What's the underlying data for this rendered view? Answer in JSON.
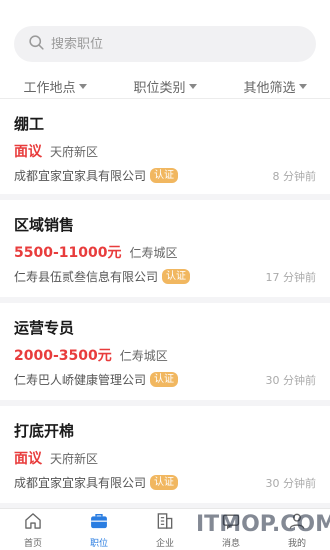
{
  "search": {
    "placeholder": "搜索职位",
    "value": ""
  },
  "filters": [
    {
      "label": "工作地点"
    },
    {
      "label": "职位类别"
    },
    {
      "label": "其他筛选"
    }
  ],
  "jobs": [
    {
      "title": "绷工",
      "salary": "面议",
      "location": "天府新区",
      "company": "成都宜家宜家具有限公司",
      "badge": "认证",
      "time": "8 分钟前"
    },
    {
      "title": "区域销售",
      "salary": "5500-11000元",
      "location": "仁寿城区",
      "company": "仁寿县伍贰叁信息有限公司",
      "badge": "认证",
      "time": "17 分钟前"
    },
    {
      "title": "运营专员",
      "salary": "2000-3500元",
      "location": "仁寿城区",
      "company": "仁寿巴人峤健康管理公司",
      "badge": "认证",
      "time": "30 分钟前"
    },
    {
      "title": "打底开棉",
      "salary": "面议",
      "location": "天府新区",
      "company": "成都宜家宜家具有限公司",
      "badge": "认证",
      "time": "30 分钟前"
    }
  ],
  "tabbar": {
    "items": [
      {
        "label": "首页",
        "icon": "home-icon"
      },
      {
        "label": "职位",
        "icon": "briefcase-icon",
        "active": true
      },
      {
        "label": "企业",
        "icon": "building-icon"
      },
      {
        "label": "消息",
        "icon": "message-icon"
      },
      {
        "label": "我的",
        "icon": "user-icon"
      }
    ]
  },
  "watermark": "ITMOP.COM",
  "colors": {
    "accent": "#2a7de1",
    "salary": "#e83c3c",
    "badge": "#f1b760"
  }
}
